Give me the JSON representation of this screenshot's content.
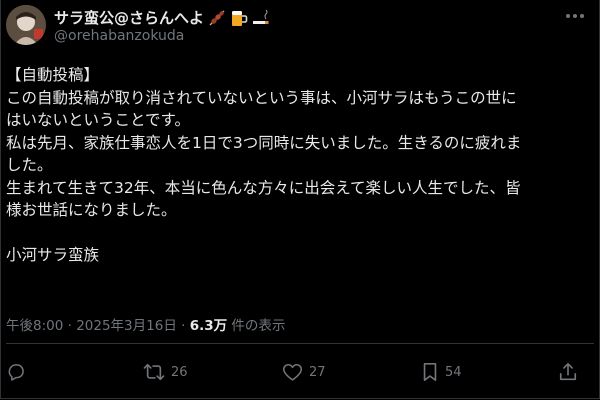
{
  "author": {
    "display_name": "サラ蛮公@さらんへよ",
    "handle": "@orehabanzokuda",
    "name_emojis": [
      "meat-skewer-icon",
      "beer-mug-icon",
      "cigarette-icon"
    ]
  },
  "post": {
    "lines": [
      "【自動投稿】",
      "この自動投稿が取り消されていないという事は、小河サラはもうこの世に",
      "はいないということです。",
      "私は先月、家族仕事恋人を1日で3つ同時に失いました。生きるのに疲れま",
      "した。",
      "生まれて生きて32年、本当に色んな方々に出会えて楽しい人生でした、皆",
      "様お世話になりました。",
      "",
      "小河サラ蛮族"
    ]
  },
  "meta": {
    "time": "午後8:00",
    "separator": " · ",
    "date": "2025年3月16日",
    "views_count": "6.3万",
    "views_label": " 件の表示"
  },
  "actions": {
    "reply_icon": "reply-icon",
    "retweet_icon": "retweet-icon",
    "retweet_count": "26",
    "like_icon": "heart-icon",
    "like_count": "27",
    "bookmark_icon": "bookmark-icon",
    "bookmark_count": "54",
    "share_icon": "share-icon"
  },
  "colors": {
    "background": "#000000",
    "text": "#e7e9ea",
    "muted": "#71767b",
    "divider": "#2f3336"
  }
}
